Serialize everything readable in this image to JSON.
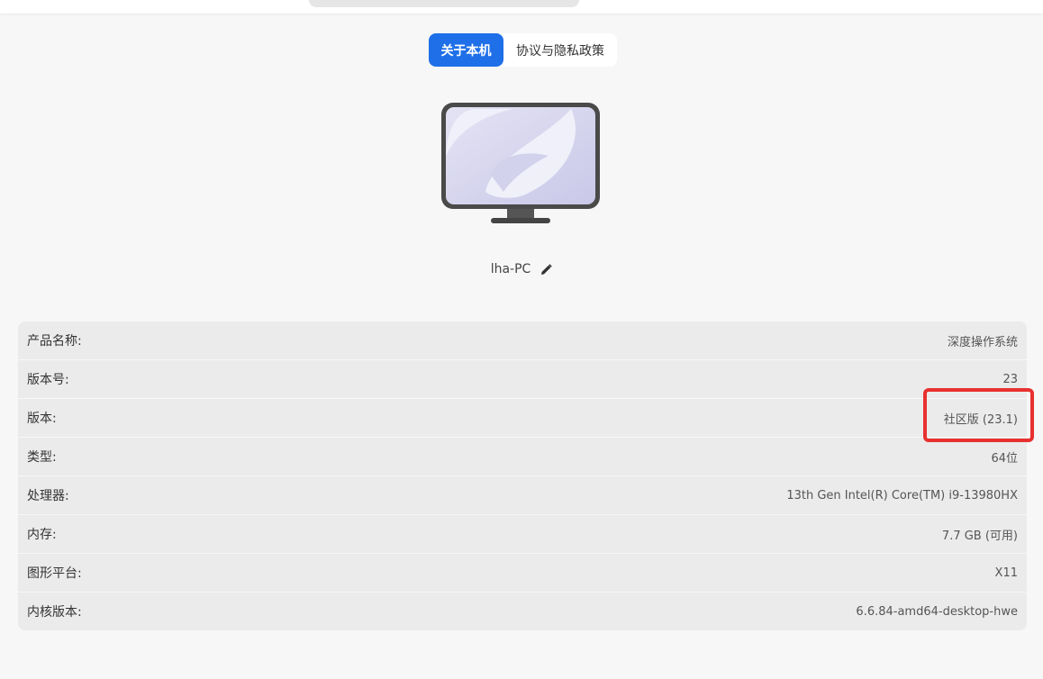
{
  "tabs": [
    {
      "label": "关于本机",
      "active": true
    },
    {
      "label": "协议与隐私政策",
      "active": false
    }
  ],
  "device": {
    "hostname": "lha-PC",
    "icon": "monitor-icon",
    "edit_icon": "pencil-icon"
  },
  "info": [
    {
      "label": "产品名称:",
      "value": "深度操作系统"
    },
    {
      "label": "版本号:",
      "value": "23"
    },
    {
      "label": "版本:",
      "value": "社区版 (23.1)"
    },
    {
      "label": "类型:",
      "value": "64位"
    },
    {
      "label": "处理器:",
      "value": "13th Gen Intel(R) Core(TM) i9-13980HX"
    },
    {
      "label": "内存:",
      "value": "7.7 GB (可用)"
    },
    {
      "label": "图形平台:",
      "value": "X11"
    },
    {
      "label": "内核版本:",
      "value": "6.6.84-amd64-desktop-hwe"
    }
  ],
  "colors": {
    "accent": "#1f6fe8",
    "highlight": "#e8312f"
  }
}
